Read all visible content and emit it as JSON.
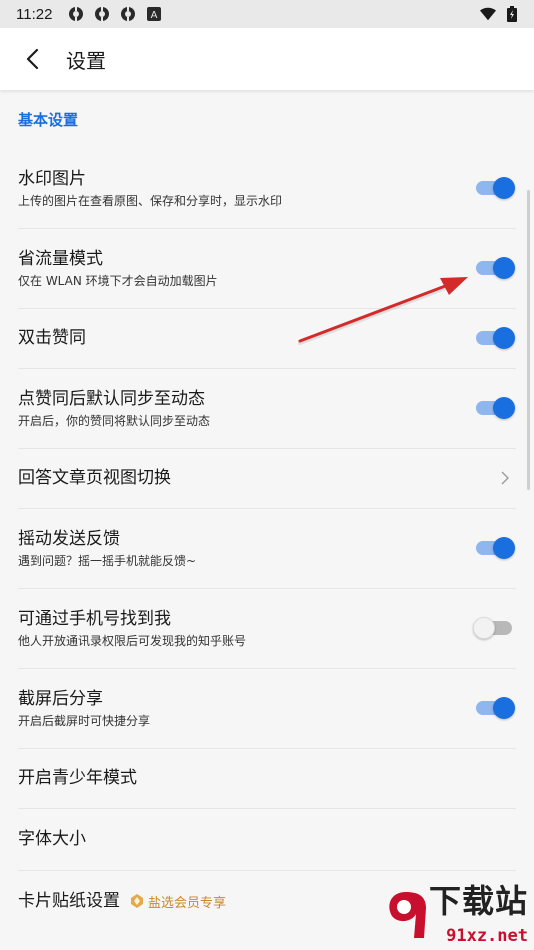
{
  "status_bar": {
    "time": "11:22",
    "icons": [
      "sync-icon",
      "sync-icon",
      "sync-icon",
      "keyboard-a-icon"
    ],
    "right_icons": [
      "wifi-icon",
      "battery-icon"
    ]
  },
  "app_bar": {
    "title": "设置"
  },
  "section": {
    "title": "基本设置"
  },
  "settings": [
    {
      "title": "水印图片",
      "subtitle": "上传的图片在查看原图、保存和分享时，显示水印",
      "control": "toggle",
      "on": true
    },
    {
      "title": "省流量模式",
      "subtitle": "仅在 WLAN 环境下才会自动加载图片",
      "control": "toggle",
      "on": true
    },
    {
      "title": "双击赞同",
      "subtitle": "",
      "control": "toggle",
      "on": true
    },
    {
      "title": "点赞同后默认同步至动态",
      "subtitle": "开启后，你的赞同将默认同步至动态",
      "control": "toggle",
      "on": true
    },
    {
      "title": "回答文章页视图切换",
      "subtitle": "",
      "control": "chevron"
    },
    {
      "title": "摇动发送反馈",
      "subtitle": "遇到问题？摇一摇手机就能反馈~",
      "control": "toggle",
      "on": true
    },
    {
      "title": "可通过手机号找到我",
      "subtitle": "他人开放通讯录权限后可发现我的知乎账号",
      "control": "toggle",
      "on": false
    },
    {
      "title": "截屏后分享",
      "subtitle": "开启后截屏时可快捷分享",
      "control": "toggle",
      "on": true
    },
    {
      "title": "开启青少年模式",
      "subtitle": "",
      "control": "none"
    },
    {
      "title": "字体大小",
      "subtitle": "",
      "control": "none"
    },
    {
      "title": "卡片贴纸设置",
      "subtitle": "",
      "control": "none",
      "badge": "盐选会员专享"
    }
  ],
  "watermark": {
    "brand": "下载站",
    "url": "91xz.net"
  },
  "colors": {
    "accent": "#1a6fe0",
    "toggle_track_on": "#8fb6ee",
    "badge": "#c8882a",
    "annotation_arrow": "#d42a2a"
  }
}
